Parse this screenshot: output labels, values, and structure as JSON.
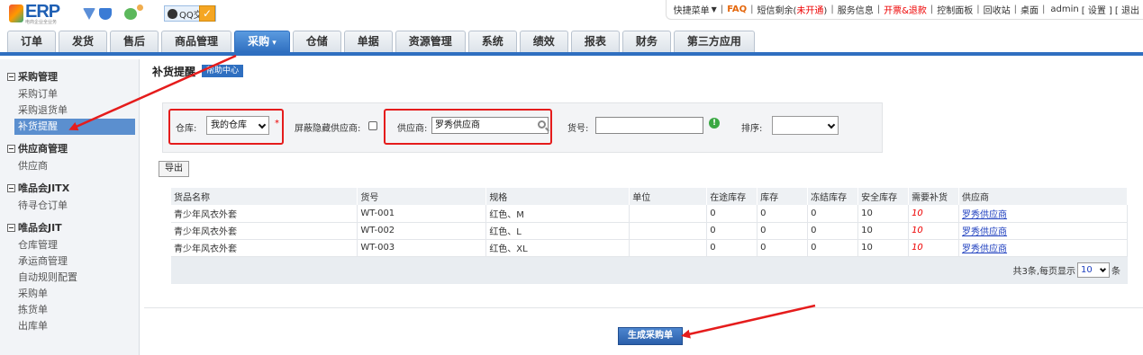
{
  "header": {
    "logo_text": "ERP",
    "logo_sub": "电商企业全业务",
    "qq_label": "QQ交谈",
    "links": {
      "quick_menu": "快捷菜单",
      "faq": "FAQ",
      "sms_prefix": "短信剩余(",
      "sms_status": "未开通",
      "sms_suffix": ")",
      "service": "服务信息",
      "invoice": "开票&退款",
      "control": "控制面板",
      "recycle": "回收站",
      "desktop": "桌面",
      "user": "admin",
      "settings": "[ 设置 ]",
      "logout": "[ 退出"
    }
  },
  "nav": [
    "订单",
    "发货",
    "售后",
    "商品管理",
    "采购",
    "仓储",
    "单据",
    "资源管理",
    "系统",
    "绩效",
    "报表",
    "财务",
    "第三方应用"
  ],
  "nav_active": "采购",
  "sidebar": {
    "sections": [
      {
        "title": "采购管理",
        "items": [
          "采购订单",
          "采购退货单",
          "补货提醒"
        ]
      },
      {
        "title": "供应商管理",
        "items": [
          "供应商"
        ]
      },
      {
        "title": "唯品会JITX",
        "items": [
          "待寻仓订单"
        ]
      },
      {
        "title": "唯品会JIT",
        "items": [
          "仓库管理",
          "承运商管理",
          "自动规则配置",
          "采购单",
          "拣货单",
          "出库单"
        ]
      }
    ],
    "active_item": "补货提醒"
  },
  "page": {
    "title": "补货提醒",
    "tag": "帮助中心",
    "filter": {
      "warehouse_label": "仓库:",
      "warehouse_value": "我的仓库",
      "hide_supplier_label": "屏蔽隐藏供应商:",
      "supplier_label": "供应商:",
      "supplier_value": "罗秀供应商",
      "sku_label": "货号:",
      "sku_value": "",
      "sort_label": "排序:",
      "sort_value": ""
    },
    "export_label": "导出",
    "table": {
      "headers": [
        "货品名称",
        "货号",
        "规格",
        "单位",
        "在途库存",
        "库存",
        "冻结库存",
        "安全库存",
        "需要补货",
        "供应商"
      ],
      "rows": [
        [
          "青少年风衣外套",
          "WT-001",
          "红色、M",
          "",
          "0",
          "0",
          "0",
          "10",
          "10",
          "罗秀供应商"
        ],
        [
          "青少年风衣外套",
          "WT-002",
          "红色、L",
          "",
          "0",
          "0",
          "0",
          "10",
          "10",
          "罗秀供应商"
        ],
        [
          "青少年风衣外套",
          "WT-003",
          "红色、XL",
          "",
          "0",
          "0",
          "0",
          "10",
          "10",
          "罗秀供应商"
        ]
      ]
    },
    "pagination": {
      "prefix": "共3条,每页显示",
      "size": "10",
      "suffix": "条"
    },
    "generate_button": "生成采购单"
  },
  "colors": {
    "accent": "#2f6fc0",
    "annotation": "#e51c1c"
  }
}
